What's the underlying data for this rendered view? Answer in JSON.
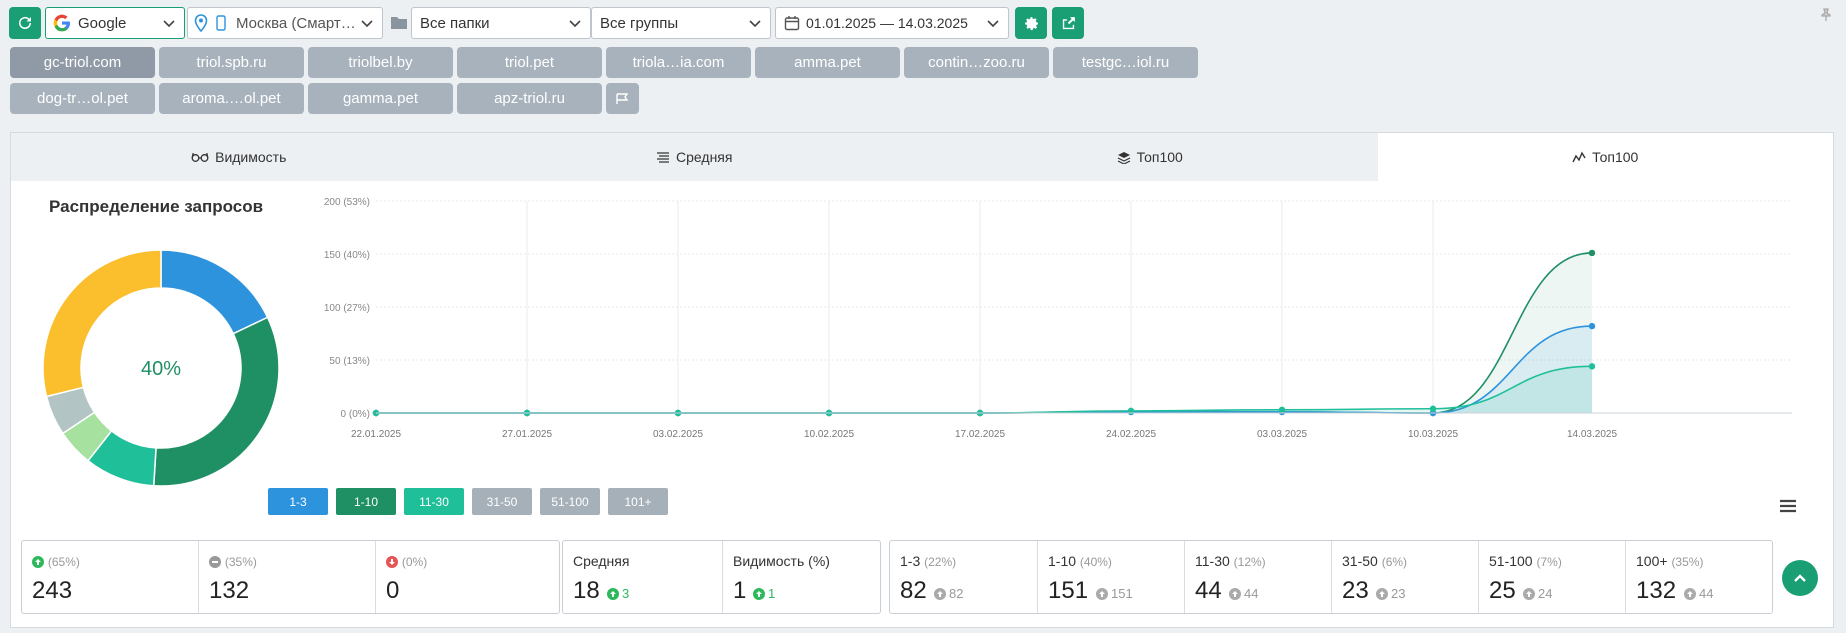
{
  "toolbar": {
    "search_engine": "Google",
    "region": "Москва (Смарт…",
    "folders": "Все папки",
    "groups": "Все группы",
    "date_range": "01.01.2025 — 14.03.2025"
  },
  "sites": [
    {
      "label": "gc-triol.com",
      "active": true
    },
    {
      "label": "triol.spb.ru"
    },
    {
      "label": "triolbel.by"
    },
    {
      "label": "triol.pet"
    },
    {
      "label": "triola…ia.com"
    },
    {
      "label": "amma.pet"
    },
    {
      "label": "contin…zoo.ru"
    },
    {
      "label": "testgc…iol.ru"
    },
    {
      "label": "dog-tr…ol.pet"
    },
    {
      "label": "aroma.…ol.pet"
    },
    {
      "label": "gamma.pet"
    },
    {
      "label": "apz-triol.ru"
    }
  ],
  "tabs": [
    {
      "label": "Видимость",
      "icon": "glasses-icon"
    },
    {
      "label": "Средняя",
      "icon": "lines-icon"
    },
    {
      "label": "Топ100",
      "icon": "layers-icon"
    },
    {
      "label": "Топ100",
      "icon": "chart-line-icon",
      "active": true
    }
  ],
  "donut": {
    "title": "Распределение запросов",
    "center_label": "40%"
  },
  "colors": {
    "c1_3": "#2e93dd",
    "c1_10": "#1f8f64",
    "c11_30": "#1fbf9a",
    "c31_50": "#a6e1a0",
    "c51_100": "#b3c4c4",
    "c100p": "#fbbf2d",
    "accent": "#1a9e73"
  },
  "chart_data": [
    {
      "type": "pie",
      "labels": [
        "1-3",
        "1-10",
        "11-30",
        "31-50",
        "51-100",
        "100+"
      ],
      "values": [
        82,
        151,
        44,
        23,
        25,
        132
      ],
      "center_label": "40%"
    },
    {
      "type": "area",
      "x": [
        "22.01.2025",
        "27.01.2025",
        "03.02.2025",
        "10.02.2025",
        "17.02.2025",
        "24.02.2025",
        "03.03.2025",
        "10.03.2025",
        "14.03.2025"
      ],
      "ylim": [
        0,
        200
      ],
      "yticks": [
        {
          "value": 0,
          "label": "0 (0%)"
        },
        {
          "value": 50,
          "label": "50 (13%)"
        },
        {
          "value": 100,
          "label": "100 (27%)"
        },
        {
          "value": 150,
          "label": "150 (40%)"
        },
        {
          "value": 200,
          "label": "200 (53%)"
        }
      ],
      "grid": true,
      "series": [
        {
          "name": "1-10",
          "values": [
            0,
            0,
            0,
            0,
            0,
            1,
            1,
            0,
            151
          ]
        },
        {
          "name": "1-3",
          "values": [
            0,
            0,
            0,
            0,
            0,
            1,
            1,
            0,
            82
          ]
        },
        {
          "name": "11-30",
          "values": [
            0,
            0,
            0,
            0,
            0,
            2,
            3,
            4,
            44
          ]
        }
      ],
      "legend": [
        "1-3",
        "1-10",
        "11-30",
        "31-50",
        "51-100",
        "101+"
      ],
      "legend_placement": "bottom-left"
    }
  ],
  "stats": {
    "up": {
      "pct": "(65%)",
      "value": "243"
    },
    "same": {
      "pct": "(35%)",
      "value": "132"
    },
    "down": {
      "pct": "(0%)",
      "value": "0"
    },
    "avg": {
      "label": "Средняя",
      "value": "18",
      "delta": "3"
    },
    "vis": {
      "label": "Видимость (%)",
      "value": "1",
      "delta": "1"
    },
    "ranges": [
      {
        "label": "1-3",
        "pct": "(22%)",
        "value": "82",
        "delta": "82"
      },
      {
        "label": "1-10",
        "pct": "(40%)",
        "value": "151",
        "delta": "151"
      },
      {
        "label": "11-30",
        "pct": "(12%)",
        "value": "44",
        "delta": "44"
      },
      {
        "label": "31-50",
        "pct": "(6%)",
        "value": "23",
        "delta": "23"
      },
      {
        "label": "51-100",
        "pct": "(7%)",
        "value": "25",
        "delta": "24"
      },
      {
        "label": "100+",
        "pct": "(35%)",
        "value": "132",
        "delta": "44"
      }
    ]
  }
}
